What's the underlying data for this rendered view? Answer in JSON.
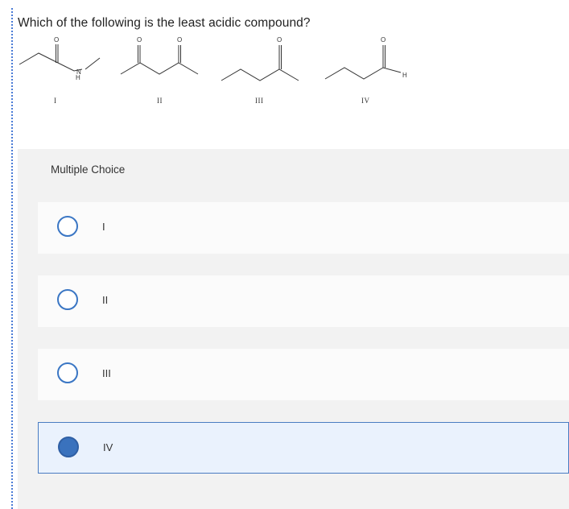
{
  "question": {
    "text": "Which of the following is the least acidic compound?"
  },
  "structures": [
    {
      "label": "I",
      "carbonyl_o": "O",
      "heteroatom": "N",
      "heteroatom_h": "H"
    },
    {
      "label": "II",
      "carbonyl_o1": "O",
      "carbonyl_o2": "O"
    },
    {
      "label": "III",
      "carbonyl_o": "O"
    },
    {
      "label": "IV",
      "carbonyl_o": "O",
      "aldehyde_h": "H"
    }
  ],
  "multiple_choice": {
    "header": "Multiple Choice",
    "options": [
      {
        "label": "I",
        "selected": false
      },
      {
        "label": "II",
        "selected": false
      },
      {
        "label": "III",
        "selected": false
      },
      {
        "label": "IV",
        "selected": true
      }
    ]
  },
  "colors": {
    "radio_border": "#3a76c4",
    "radio_selected": "#3a72bd",
    "selected_bg": "#eaf2fd",
    "panel_bg": "#f2f2f2"
  }
}
